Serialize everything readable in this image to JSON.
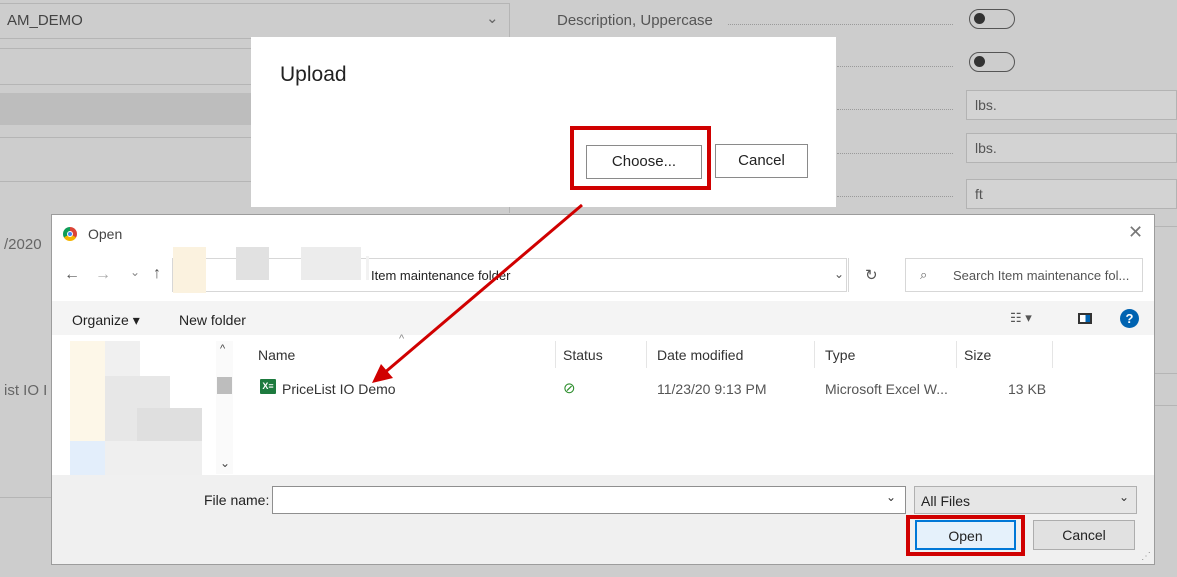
{
  "background": {
    "field_value": "AM_DEMO",
    "description_label": "Description, Uppercase",
    "unit_1": "lbs.",
    "unit_2": "lbs.",
    "unit_3": "ft",
    "date_fragment": "/2020",
    "item_fragment": "ist IO I"
  },
  "upload_dialog": {
    "title": "Upload",
    "choose_label": "Choose...",
    "cancel_label": "Cancel"
  },
  "open_dialog": {
    "title": "Open",
    "path": "Item maintenance folder",
    "search_placeholder": "Search Item maintenance fol...",
    "organize_label": "Organize ▾",
    "new_folder_label": "New folder",
    "columns": [
      "Name",
      "Status",
      "Date modified",
      "Type",
      "Size"
    ],
    "files": [
      {
        "name": "PriceList IO Demo",
        "date": "11/23/20 9:13 PM",
        "type": "Microsoft Excel W...",
        "size": "13 KB"
      }
    ],
    "file_name_label": "File name:",
    "file_name_value": "",
    "filter_label": "All Files",
    "open_label": "Open",
    "cancel_label": "Cancel"
  },
  "colors": {
    "highlight": "#d00000",
    "excel_green": "#1d7a3e",
    "help_blue": "#0063b1"
  }
}
